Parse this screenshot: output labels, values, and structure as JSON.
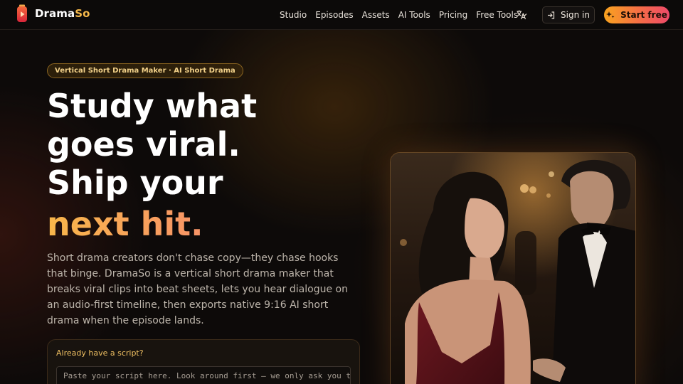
{
  "brand": {
    "name_part1": "Drama",
    "name_part2": "So"
  },
  "nav": {
    "links": [
      "Studio",
      "Episodes",
      "Assets",
      "AI Tools",
      "Pricing"
    ],
    "free_tools": "Free Tools",
    "sign_in": "Sign in",
    "start_free": "Start free"
  },
  "hero": {
    "badge": "Vertical Short Drama Maker · AI Short Drama",
    "headline_lines": [
      "Study what",
      "goes viral.",
      "Ship your"
    ],
    "headline_accent": "next hit.",
    "description": "Short drama creators don't chase copy—they chase hooks that binge. DramaSo is a vertical short drama maker that breaks viral clips into beat sheets, lets you hear dialogue on an audio-first timeline, then exports native 9:16 AI short drama when the episode lands."
  },
  "script_box": {
    "label": "Already have a script?",
    "placeholder": "Paste your script here. Look around first — we only ask you to"
  },
  "icons": {
    "logo": "phone-play-icon",
    "free_tools": "chevron-down-icon",
    "language": "translate-icon",
    "sign_in": "sign-in-icon",
    "start_free": "sparkle-icon"
  },
  "colors": {
    "background": "#0d0a09",
    "brand_accent": "#f6b94a",
    "cta_gradient_start": "#f9a31f",
    "cta_gradient_end": "#ee4a6a",
    "badge_text": "#f3d28a"
  }
}
